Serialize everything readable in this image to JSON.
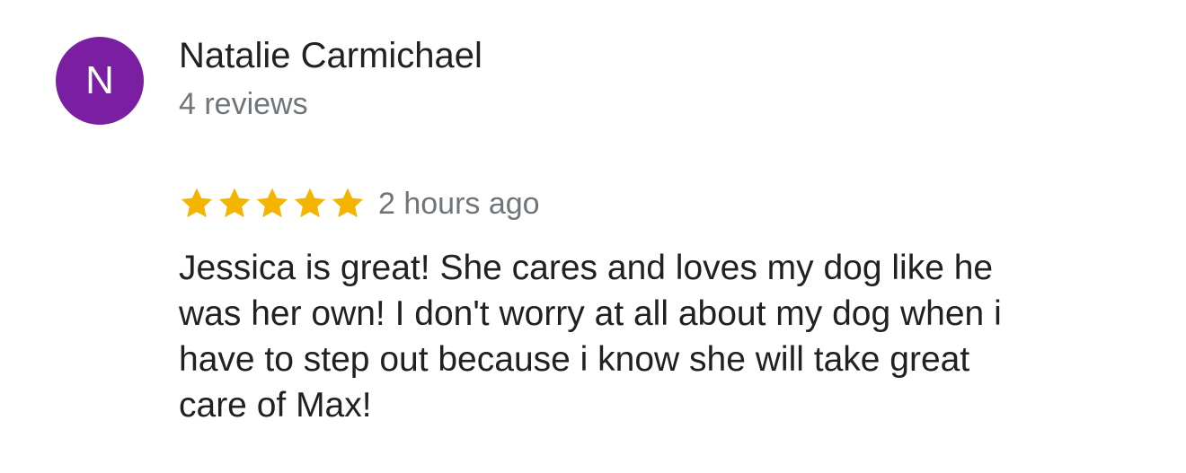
{
  "reviewer": {
    "initial": "N",
    "avatar_color": "#7b1fa2",
    "name": "Natalie Carmichael",
    "review_count": "4 reviews"
  },
  "rating": {
    "stars": 5,
    "max_stars": 5,
    "star_color": "#f4b400",
    "icon": "star-icon",
    "timestamp": "2 hours ago"
  },
  "review": {
    "lines": [
      "Jessica is great! She cares and loves my dog like he",
      "was her own! I don't worry at all about my dog when i",
      "have to step out because i know she will take great",
      "care of Max!"
    ]
  }
}
